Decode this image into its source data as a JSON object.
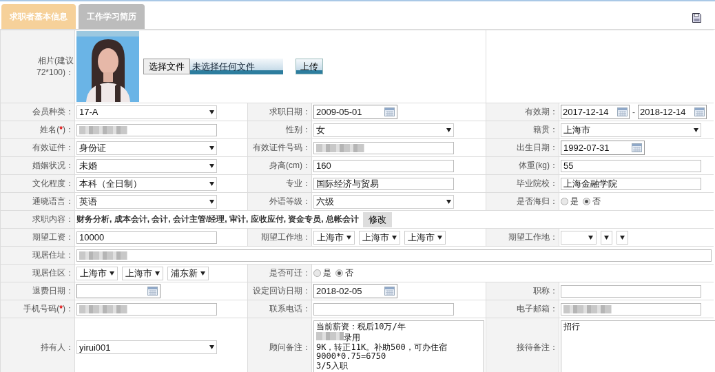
{
  "tabs": [
    {
      "label": "求职者基本信息",
      "selected": true
    },
    {
      "label": "工作学习简历",
      "selected": false
    }
  ],
  "rows": [
    {
      "cells": [
        {
          "label": "相片(建议72*100)：",
          "field": {
            "choose_button": "选择文件",
            "file_status": "未选择任何文件",
            "upload_button": "上传"
          }
        }
      ]
    },
    {
      "cells": [
        {
          "label": "会员种类：",
          "field": {
            "kind": "select",
            "value": "17-A"
          }
        },
        {
          "label": "求职日期：",
          "field": {
            "kind": "date",
            "value": "2009-05-01"
          }
        },
        {
          "label": "有效期：",
          "field": {
            "kind": "daterange",
            "from": "2017-12-14",
            "separator": "-",
            "to": "2018-12-14"
          }
        }
      ]
    },
    {
      "cells": [
        {
          "label": "姓名(",
          "star": "*",
          "label_end": ")：",
          "field": {
            "kind": "text",
            "redacted": true
          }
        },
        {
          "label": "性别：",
          "field": {
            "kind": "select",
            "value": "女"
          }
        },
        {
          "label": "籍贯：",
          "field": {
            "kind": "select",
            "value": "上海市"
          }
        }
      ]
    },
    {
      "cells": [
        {
          "label": "有效证件：",
          "field": {
            "kind": "select",
            "value": "身份证"
          }
        },
        {
          "label": "有效证件号码：",
          "field": {
            "kind": "text",
            "redacted": true
          }
        },
        {
          "label": "出生日期：",
          "field": {
            "kind": "date",
            "value": "1992-07-31"
          }
        }
      ]
    },
    {
      "cells": [
        {
          "label": "婚姻状况：",
          "field": {
            "kind": "select",
            "value": "未婚"
          }
        },
        {
          "label": "身高(cm)：",
          "field": {
            "kind": "text",
            "value": "160"
          }
        },
        {
          "label": "体重(kg)：",
          "field": {
            "kind": "text",
            "value": "55"
          }
        }
      ]
    },
    {
      "cells": [
        {
          "label": "文化程度：",
          "field": {
            "kind": "select",
            "value": "本科（全日制）"
          }
        },
        {
          "label": "专业：",
          "field": {
            "kind": "text",
            "value": "国际经济与贸易"
          }
        },
        {
          "label": "毕业院校：",
          "field": {
            "kind": "text",
            "value": "上海金融学院"
          }
        }
      ]
    },
    {
      "cells": [
        {
          "label": "通晓语言：",
          "field": {
            "kind": "select",
            "value": "英语"
          }
        },
        {
          "label": "外语等级：",
          "field": {
            "kind": "select",
            "value": "六级"
          }
        },
        {
          "label": "是否海归：",
          "field": {
            "kind": "radio",
            "options": [
              {
                "label": "是",
                "selected": false
              },
              {
                "label": "否",
                "selected": true
              }
            ]
          }
        }
      ]
    },
    {
      "cells": [
        {
          "label": "求职内容：",
          "field": {
            "kind": "tags",
            "text": "财务分析, 成本会计, 会计, 会计主管/经理, 审计, 应收应付, 资金专员, 总帐会计",
            "button": "修改"
          }
        }
      ]
    },
    {
      "cells": [
        {
          "label": "期望工资：",
          "field": {
            "kind": "text",
            "value": "10000"
          }
        },
        {
          "label": "期望工作地：",
          "field": {
            "kind": "selects",
            "items": [
              {
                "value": "上海市"
              },
              {
                "value": "上海市"
              },
              {
                "value": "上海市"
              }
            ]
          }
        },
        {
          "label": "期望工作地：",
          "field": {
            "kind": "selects",
            "items": [
              {
                "kind": "select"
              },
              {
                "kind": "select"
              },
              {
                "kind": "select"
              }
            ]
          }
        }
      ]
    },
    {
      "cells": [
        {
          "label": "现居住址：",
          "field": {
            "kind": "text",
            "redacted": true
          }
        }
      ]
    },
    {
      "cells": [
        {
          "label": "现居住区：",
          "field": {
            "kind": "selects",
            "items": [
              {
                "value": "上海市"
              },
              {
                "value": "上海市"
              },
              {
                "value": "浦东新"
              }
            ]
          }
        },
        {
          "label": "是否可迁：",
          "field": {
            "kind": "radio",
            "options": [
              {
                "label": "是",
                "selected": false
              },
              {
                "label": "否",
                "selected": true
              }
            ]
          }
        }
      ]
    },
    {
      "cells": [
        {
          "label": "退费日期：",
          "field": {
            "kind": "date"
          }
        },
        {
          "label": "设定回访日期：",
          "field": {
            "kind": "date",
            "value": "2018-02-05"
          }
        },
        {
          "label": "职称：",
          "field": {
            "kind": "text"
          }
        }
      ]
    },
    {
      "cells": [
        {
          "label": "手机号码(",
          "star": "*",
          "label_end": ")：",
          "field": {
            "kind": "text",
            "redacted": true
          }
        },
        {
          "label": "联系电话：",
          "field": {
            "kind": "text"
          }
        },
        {
          "label": "电子邮箱：",
          "field": {
            "kind": "text",
            "redacted": true
          }
        }
      ]
    },
    {
      "cells": [
        {
          "label": "持有人：",
          "field": {
            "kind": "select",
            "value": "yirui001"
          }
        },
        {
          "label": "顾问备注：",
          "field": {
            "kind": "textarea",
            "lines": [
              {
                "text": "当前薪资：税后10万/年"
              },
              {
                "text": "录用",
                "redacted": true
              },
              {
                "text": "9K，转正11K。补助500，可办住宿"
              },
              {
                "text": "9000*0.75=6750"
              },
              {
                "text": "3/5入职"
              }
            ]
          }
        },
        {
          "label": "接待备注：",
          "field": {
            "kind": "textarea",
            "lines": [
              {
                "text": "招行"
              }
            ]
          }
        }
      ]
    }
  ]
}
